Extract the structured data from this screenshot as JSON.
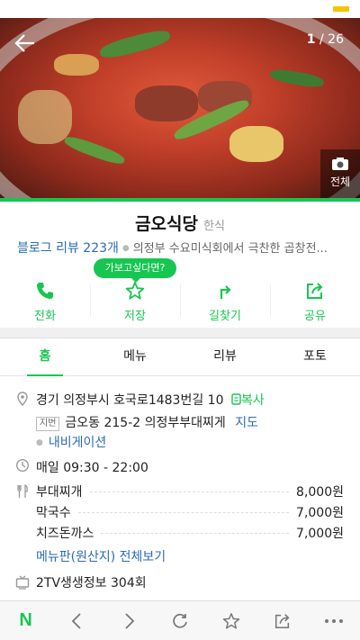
{
  "gallery": {
    "current": "1",
    "separator": "/",
    "total": "26",
    "all_label": "전체"
  },
  "place": {
    "name": "금오식당",
    "category": "한식",
    "blog_review": "블로그 리뷰 223개",
    "description": "의정부 수요미식회에서 극찬한 곱창전..."
  },
  "tooltip": "가보고싶다면?",
  "actions": [
    {
      "label": "전화",
      "icon": "phone-icon"
    },
    {
      "label": "저장",
      "icon": "star-icon"
    },
    {
      "label": "길찾기",
      "icon": "directions-icon"
    },
    {
      "label": "공유",
      "icon": "share-icon"
    }
  ],
  "tabs": [
    {
      "label": "홈",
      "active": true
    },
    {
      "label": "메뉴",
      "active": false
    },
    {
      "label": "리뷰",
      "active": false
    },
    {
      "label": "포토",
      "active": false
    }
  ],
  "address": {
    "road": "경기 의정부시 호국로1483번길 10",
    "copy_label": "복사",
    "jibun_tag": "지번",
    "jibun": "금오동 215-2 의정부부대찌게",
    "map_label": "지도",
    "navigation": "내비게이션"
  },
  "hours": "매일 09:30 - 22:00",
  "menu": {
    "items": [
      {
        "name": "부대찌개",
        "price": "8,000원"
      },
      {
        "name": "막국수",
        "price": "7,000원"
      },
      {
        "name": "치즈돈까스",
        "price": "7,000원"
      }
    ],
    "more_label": "메뉴판(원산지) 전체보기"
  },
  "tv": "2TV생생정보 304회",
  "browser": {
    "logo": "N"
  },
  "colors": {
    "accent": "#17c651",
    "link": "#2d6bb3"
  }
}
